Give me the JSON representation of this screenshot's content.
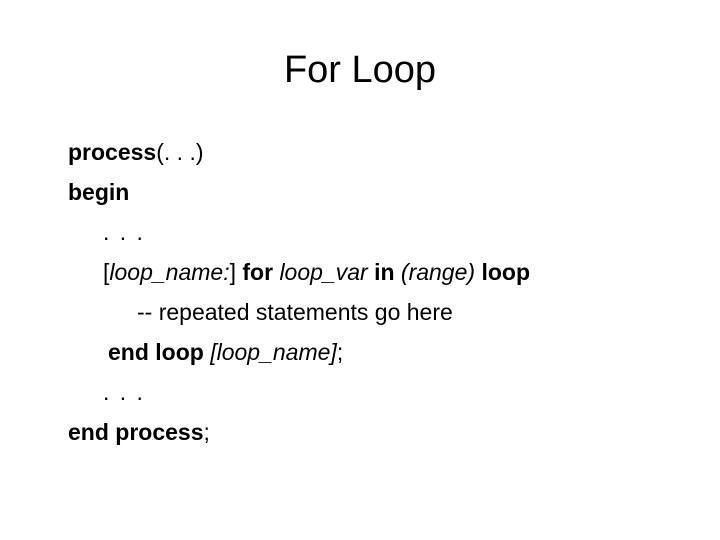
{
  "slide": {
    "title": "For Loop",
    "background_color": "#ffffff",
    "text_color": "#000000"
  },
  "code": {
    "lines": [
      {
        "id": "line-process",
        "indent": 0,
        "segments": [
          {
            "text": "process",
            "style": "keyword"
          },
          {
            "text": "(. . .)",
            "style": "plain"
          }
        ]
      },
      {
        "id": "line-begin",
        "indent": 0,
        "segments": [
          {
            "text": "begin",
            "style": "keyword"
          }
        ]
      },
      {
        "id": "line-ellipsis-top",
        "indent": 1,
        "segments": [
          {
            "text": ". . .",
            "style": "plain"
          }
        ]
      },
      {
        "id": "line-for",
        "indent": 1,
        "segments": [
          {
            "text": "[",
            "style": "bracket"
          },
          {
            "text": "loop_name:",
            "style": "italic"
          },
          {
            "text": "]",
            "style": "bracket"
          },
          {
            "text": " ",
            "style": "plain"
          },
          {
            "text": "for",
            "style": "keyword"
          },
          {
            "text": " ",
            "style": "plain"
          },
          {
            "text": "loop_var",
            "style": "italic"
          },
          {
            "text": " ",
            "style": "plain"
          },
          {
            "text": "in",
            "style": "keyword"
          },
          {
            "text": " ",
            "style": "plain"
          },
          {
            "text": "(range)",
            "style": "italic"
          },
          {
            "text": " ",
            "style": "plain"
          },
          {
            "text": "loop",
            "style": "keyword"
          }
        ]
      },
      {
        "id": "line-comment",
        "indent": 3,
        "segments": [
          {
            "text": "-- repeated statements go here",
            "style": "plain"
          }
        ]
      },
      {
        "id": "line-end-loop",
        "indent": 2,
        "segments": [
          {
            "text": "end loop",
            "style": "keyword"
          },
          {
            "text": " ",
            "style": "plain"
          },
          {
            "text": "[loop_name]",
            "style": "italic"
          },
          {
            "text": ";",
            "style": "plain"
          }
        ]
      },
      {
        "id": "line-ellipsis-bottom",
        "indent": 1,
        "segments": [
          {
            "text": ". . .",
            "style": "plain"
          }
        ]
      },
      {
        "id": "line-end-process",
        "indent": 0,
        "segments": [
          {
            "text": "end process",
            "style": "keyword"
          },
          {
            "text": ";",
            "style": "plain"
          }
        ]
      }
    ]
  },
  "text": {
    "line_1_full": "process(. . .)",
    "line_2_full": "begin",
    "line_3_full": ". . .",
    "line_4_full": "[loop_name:] for loop_var in (range) loop",
    "line_5_full": "-- repeated statements go here",
    "line_6_full": "end loop [loop_name];",
    "line_7_full": ". . .",
    "line_8_full": "end process;"
  }
}
